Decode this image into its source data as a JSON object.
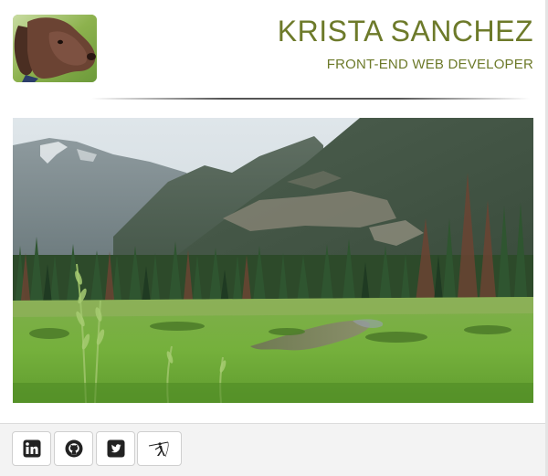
{
  "profile": {
    "name": "KRISTA SANCHEZ",
    "title": "FRONT-END WEB DEVELOPER",
    "avatar_icon": "puppy-photo"
  },
  "hero": {
    "image_icon": "mountain-meadow-photo"
  },
  "social": [
    {
      "id": "linkedin",
      "icon": "linkedin-icon"
    },
    {
      "id": "github",
      "icon": "github-icon"
    },
    {
      "id": "twitter",
      "icon": "twitter-icon"
    },
    {
      "id": "fly-fishing",
      "icon": "fisherman-icon"
    }
  ],
  "colors": {
    "accent": "#6d7a2a",
    "footer_bg": "#f3f3f3",
    "icon": "#222222"
  }
}
